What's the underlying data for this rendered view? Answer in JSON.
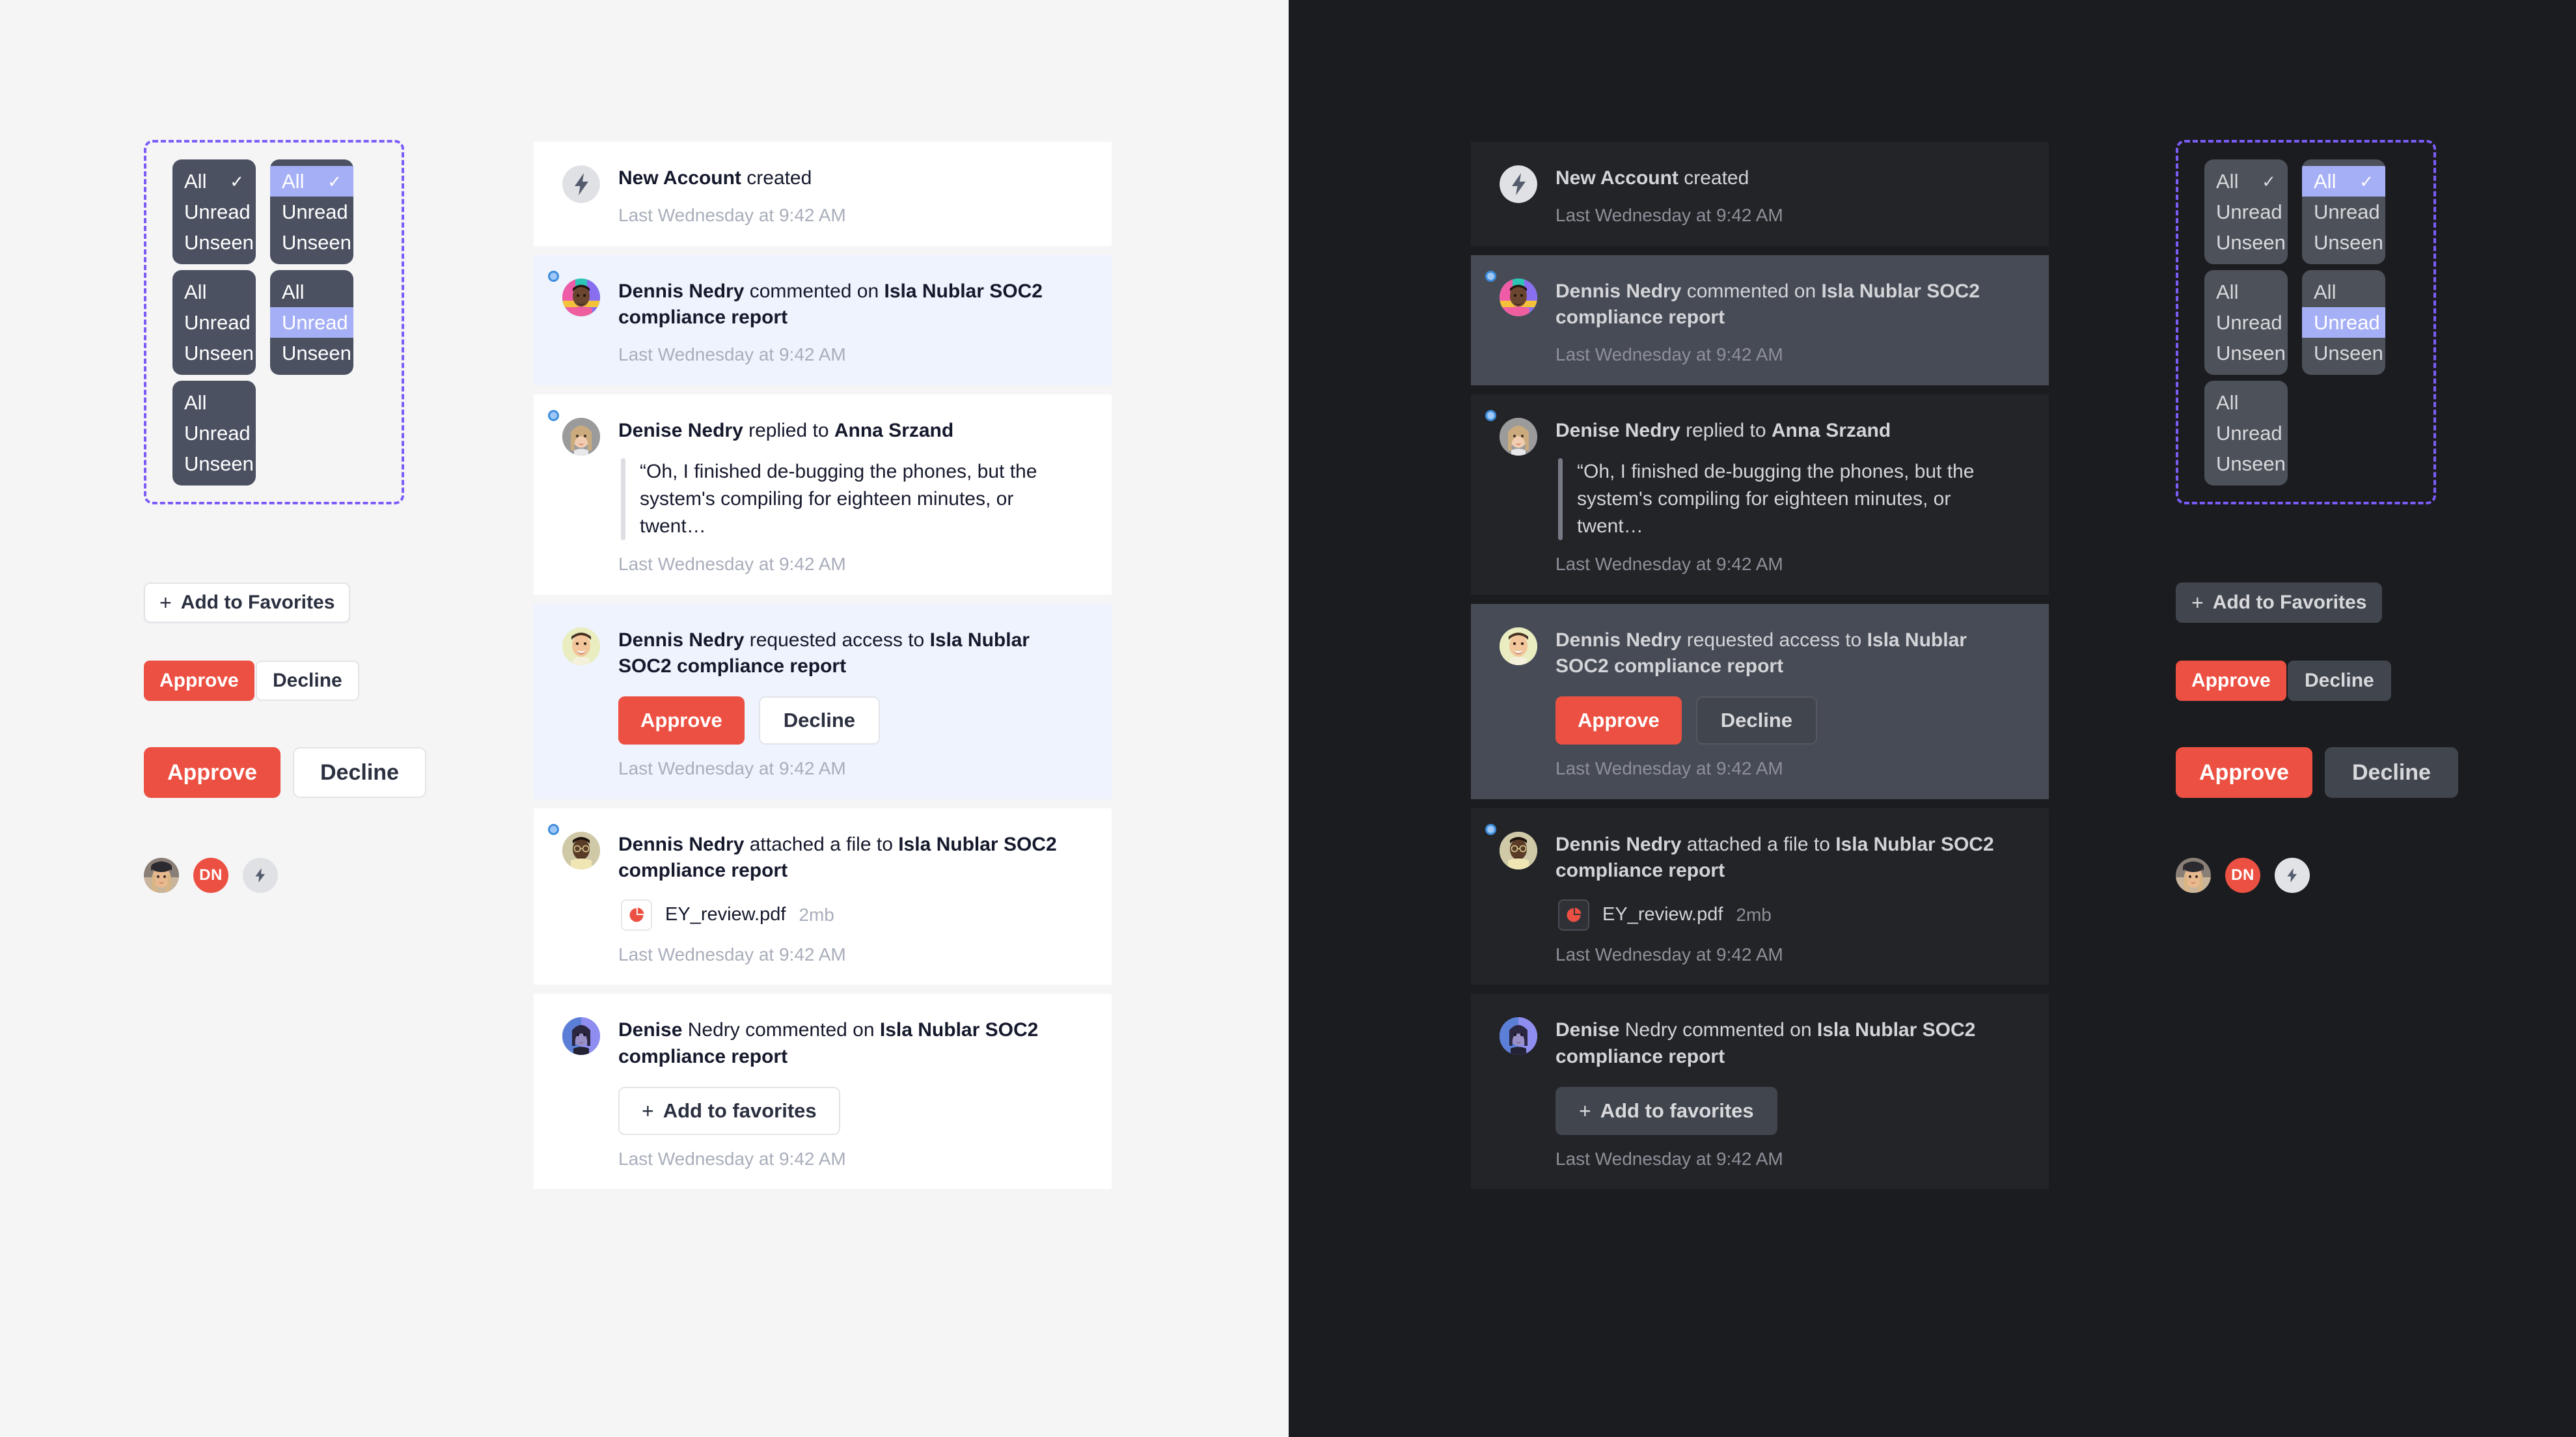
{
  "theme": {
    "light_bg": "#f5f5f6",
    "dark_bg": "#1b1c1f",
    "accent_red": "#ec5042",
    "spec_frame_color": "#7c5cfa",
    "menu_bg": "#4b5161",
    "menu_highlight": "#a5aff5",
    "unread_card_light": "#eef3fd",
    "unread_card_dark": "#474b55"
  },
  "dropdown_options": {
    "all": "All",
    "unread": "Unread",
    "unseen": "Unseen",
    "check": "✓"
  },
  "dropdown_variants": [
    {
      "name": "all-checked",
      "checked": "All",
      "highlight": null
    },
    {
      "name": "all-checked-highlighted",
      "checked": "All",
      "highlight": "All"
    },
    {
      "name": "unread-checked",
      "checked": "Unread",
      "highlight": null
    },
    {
      "name": "unseen-checked-unread-highlighted",
      "checked": "Unseen",
      "highlight": "Unread"
    },
    {
      "name": "unseen-checked",
      "checked": "Unseen",
      "highlight": null
    }
  ],
  "buttons": {
    "add_to_favorites": "Add to Favorites",
    "add_to_favorites_lower": "Add to favorites",
    "approve": "Approve",
    "decline": "Decline",
    "plus": "+"
  },
  "avatar_swatches": [
    {
      "name": "photo-woman-beanie",
      "type": "photo"
    },
    {
      "name": "initials-dn",
      "type": "initials",
      "label": "DN"
    },
    {
      "name": "system-bolt",
      "type": "icon",
      "icon": "bolt-icon"
    }
  ],
  "notifications": [
    {
      "id": "new-account",
      "kind": "system",
      "avatar": "bolt-icon",
      "unread": false,
      "dot": false,
      "segments": [
        {
          "text": "New Account",
          "bold": true
        },
        {
          "text": " created",
          "bold": false
        }
      ],
      "timestamp": "Last Wednesday at 9:42 AM"
    },
    {
      "id": "dennis-commented",
      "kind": "comment",
      "avatar": "photo-dennis-colorful",
      "unread": true,
      "dot": true,
      "segments": [
        {
          "text": "Dennis Nedry",
          "bold": true
        },
        {
          "text": " commented on ",
          "bold": false
        },
        {
          "text": "Isla Nublar SOC2 compliance report",
          "bold": true
        }
      ],
      "timestamp": "Last Wednesday at 9:42 AM"
    },
    {
      "id": "denise-replied",
      "kind": "reply",
      "avatar": "photo-denise-blonde",
      "unread": false,
      "dot": true,
      "segments": [
        {
          "text": "Denise Nedry",
          "bold": true
        },
        {
          "text": " replied to ",
          "bold": false
        },
        {
          "text": "Anna Srzand",
          "bold": true
        }
      ],
      "quote": "“Oh, I finished de-bugging the phones, but the system's compiling for eighteen minutes, or twent…",
      "timestamp": "Last Wednesday at 9:42 AM"
    },
    {
      "id": "dennis-requested-access",
      "kind": "request",
      "avatar": "photo-dennis-smiling",
      "unread": true,
      "dot": false,
      "segments": [
        {
          "text": "Dennis Nedry",
          "bold": true
        },
        {
          "text": " requested access to ",
          "bold": false
        },
        {
          "text": "Isla Nublar SOC2 compliance report",
          "bold": true
        }
      ],
      "actions": [
        "Approve",
        "Decline"
      ],
      "timestamp": "Last Wednesday at 9:42 AM"
    },
    {
      "id": "dennis-attached-file",
      "kind": "attachment",
      "avatar": "photo-dennis-glasses",
      "unread": false,
      "dot": true,
      "segments": [
        {
          "text": "Dennis Nedry",
          "bold": true
        },
        {
          "text": " attached a file to ",
          "bold": false
        },
        {
          "text": "Isla Nublar SOC2 compliance report",
          "bold": true
        }
      ],
      "file": {
        "icon": "pdf-icon",
        "name": "EY_review.pdf",
        "size": "2mb"
      },
      "timestamp": "Last Wednesday at 9:42 AM"
    },
    {
      "id": "denise-commented",
      "kind": "comment-favorite",
      "avatar": "photo-denise-purple",
      "unread": false,
      "dot": false,
      "segments": [
        {
          "text": "Denise",
          "bold": true
        },
        {
          "text": " Nedry",
          "bold": false
        },
        {
          "text": " commented on ",
          "bold": false
        },
        {
          "text": "Isla Nublar SOC2 compliance report",
          "bold": true
        }
      ],
      "favorite_action": "Add to favorites",
      "timestamp": "Last Wednesday at 9:42 AM"
    }
  ]
}
